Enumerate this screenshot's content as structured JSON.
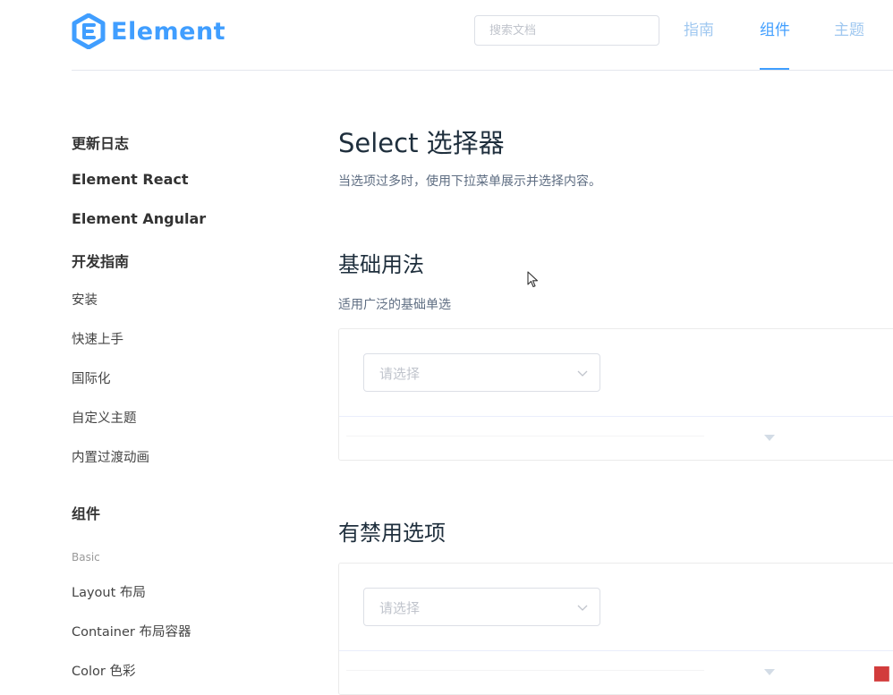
{
  "header": {
    "logo_text": "Element",
    "search_placeholder": "搜索文档",
    "nav": [
      {
        "label": "指南",
        "active": false
      },
      {
        "label": "组件",
        "active": true
      },
      {
        "label": "主题",
        "active": false
      }
    ]
  },
  "sidebar": {
    "items": [
      {
        "label": "更新日志",
        "kind": "group"
      },
      {
        "label": "Element React",
        "kind": "group"
      },
      {
        "label": "Element Angular",
        "kind": "group"
      },
      {
        "label": "开发指南",
        "kind": "group"
      },
      {
        "label": "安装",
        "kind": "link"
      },
      {
        "label": "快速上手",
        "kind": "link"
      },
      {
        "label": "国际化",
        "kind": "link"
      },
      {
        "label": "自定义主题",
        "kind": "link"
      },
      {
        "label": "内置过渡动画",
        "kind": "link"
      },
      {
        "label": "组件",
        "kind": "group"
      },
      {
        "label": "Basic",
        "kind": "subheading"
      },
      {
        "label": "Layout 布局",
        "kind": "link"
      },
      {
        "label": "Container 布局容器",
        "kind": "link"
      },
      {
        "label": "Color 色彩",
        "kind": "link"
      }
    ]
  },
  "main": {
    "title": "Select 选择器",
    "description": "当选项过多时，使用下拉菜单展示并选择内容。",
    "sections": [
      {
        "title": "基础用法",
        "description": "适用广泛的基础单选",
        "select_placeholder": "请选择"
      },
      {
        "title": "有禁用选项",
        "description": "",
        "select_placeholder": "请选择"
      }
    ]
  },
  "colors": {
    "brand": "#409eff",
    "nav_inactive": "#a0c8f0",
    "border": "#dcdfe6",
    "placeholder": "#c0c4cc"
  },
  "icons": {
    "logo": "element-logo-icon",
    "select_arrow": "chevron-down-icon",
    "expand": "caret-down-icon",
    "cursor": "mouse-pointer-icon"
  }
}
